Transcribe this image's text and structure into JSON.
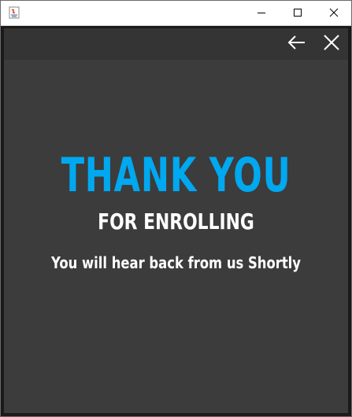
{
  "window": {
    "app_icon": "java-icon",
    "controls": {
      "minimize_icon": "minimize-icon",
      "maximize_icon": "maximize-icon",
      "close_icon": "close-icon"
    }
  },
  "toolbar": {
    "back_icon": "arrow-left-icon",
    "close_icon": "close-icon"
  },
  "message": {
    "headline": "THANK YOU",
    "subheadline": "FOR ENROLLING",
    "body": "You will hear back from us Shortly"
  },
  "colors": {
    "accent": "#00a8f0",
    "background": "#3c3c3c",
    "topbar": "#343434",
    "text": "#ffffff"
  }
}
